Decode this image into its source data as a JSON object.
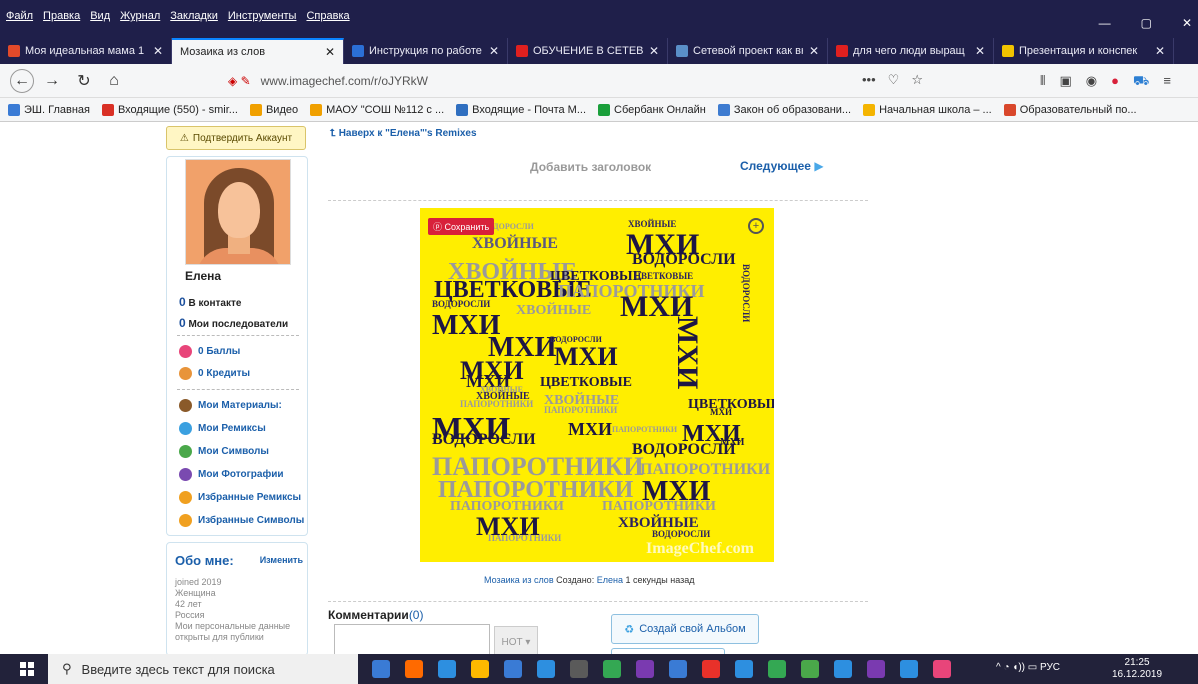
{
  "menu": [
    "Файл",
    "Правка",
    "Вид",
    "Журнал",
    "Закладки",
    "Инструменты",
    "Справка"
  ],
  "window_controls": [
    "—",
    "▢",
    "✕"
  ],
  "tabs": [
    {
      "label": "Моя идеальная мама 1",
      "icon_color": "#e24a2a",
      "active": false
    },
    {
      "label": "Мозаика из слов",
      "icon_color": "",
      "active": true
    },
    {
      "label": "Инструкция по работе",
      "icon_color": "#2b6fd6",
      "active": false
    },
    {
      "label": "ОБУЧЕНИЕ В СЕТЕВЫХ",
      "icon_color": "#e0201f",
      "active": false
    },
    {
      "label": "Сетевой проект как вне",
      "icon_color": "#5a8fc8",
      "active": false
    },
    {
      "label": "для чего люди выращ",
      "icon_color": "#e0201f",
      "active": false
    },
    {
      "label": "Презентация и конспек",
      "icon_color": "#f2c400",
      "active": false
    }
  ],
  "url": "www.imagechef.com/r/oJYRkW",
  "url_actions": [
    "•••",
    "♡",
    "☆"
  ],
  "bookmarks": [
    {
      "label": "ЭШ. Главная",
      "color": "#3a7bd5"
    },
    {
      "label": "Входящие (550) - smir...",
      "color": "#d93025"
    },
    {
      "label": "Видео",
      "color": "#f0a000"
    },
    {
      "label": "МАОУ \"СОШ №112 с ...",
      "color": "#f0a000"
    },
    {
      "label": "Входящие - Почта М...",
      "color": "#2f6fc0"
    },
    {
      "label": "Сбербанк Онлайн",
      "color": "#1a9f3b"
    },
    {
      "label": "Закон об образовани...",
      "color": "#3d7bd0"
    },
    {
      "label": "Начальная школа – ...",
      "color": "#f4b400"
    },
    {
      "label": "Образовательный по...",
      "color": "#d9472b"
    }
  ],
  "sidebar": {
    "verify": "Подтвердить Аккаунт",
    "username": "Елена",
    "stats": [
      {
        "num": "0",
        "label": "В контакте"
      },
      {
        "num": "0",
        "label": "Мои последователи"
      }
    ],
    "points": [
      {
        "label": "0 Баллы",
        "color": "#e8457a"
      },
      {
        "label": "0 Кредиты",
        "color": "#e8943a"
      }
    ],
    "links": [
      {
        "label": "Мои Материалы:",
        "color": "#8a5a2a"
      },
      {
        "label": "Мои Ремиксы",
        "color": "#3ba0e0"
      },
      {
        "label": "Мои Символы",
        "color": "#4aa84a"
      },
      {
        "label": "Мои Фотографии",
        "color": "#7a4ab0"
      },
      {
        "label": "Избранные Ремиксы",
        "color": "#f0a020"
      },
      {
        "label": "Избранные Символы",
        "color": "#f0a020"
      }
    ],
    "about": {
      "title": "Обо мне:",
      "edit": "Изменить",
      "lines": [
        "joined 2019",
        "Женщина",
        "42 лет",
        "Россия",
        "Мои персональные данные открыты для публики"
      ]
    }
  },
  "main": {
    "backlink": "Наверх к \"Елена\"'s Remixes",
    "add_title": "Добавить заголовок",
    "next": "Следующее",
    "save": "Сохранить",
    "watermark": "ImageChef.com",
    "caption_link": "Мозаика из слов",
    "caption_created": "Создано:",
    "caption_author": "Елена",
    "caption_time": "1 секунды назад",
    "comments_label": "Комментарии",
    "comments_count": "(0)",
    "create_album": "Создай свой Альбом",
    "hot_label": "HOT"
  },
  "mosaic_words": [
    {
      "t": "ВОДОРОСЛИ",
      "c": "#9b9a9a"
    },
    {
      "t": "ХВОЙНЫЕ",
      "c": "#5b5880"
    },
    {
      "t": "ХВОЙНЫЕ",
      "c": "#2b2260"
    },
    {
      "t": "МХИ",
      "c": "#1d1645"
    },
    {
      "t": "ВОДОРОСЛИ",
      "c": "#1d1645"
    },
    {
      "t": "ХВОЙНЫЕ",
      "c": "#9b9a9a"
    },
    {
      "t": "ЦВЕТКОВЫЕ",
      "c": "#1d1645"
    },
    {
      "t": "ВОДОРОСЛИ",
      "c": "#2b2260"
    },
    {
      "t": "МХИ",
      "c": "#1d1645"
    },
    {
      "t": "ЦВЕТКОВЫЕ",
      "c": "#1d1645"
    },
    {
      "t": "ПАПОРОТНИКИ",
      "c": "#9b9a9a"
    },
    {
      "t": "ЦВЕТКОВЫЕ",
      "c": "#2b2260"
    },
    {
      "t": "МХИ",
      "c": "#1d1645"
    },
    {
      "t": "ХВОЙНЫЕ",
      "c": "#9b9a9a"
    },
    {
      "t": "МХИ",
      "c": "#1d1645"
    },
    {
      "t": "МХИ",
      "c": "#1d1645"
    },
    {
      "t": "ВОДОРОСЛИ",
      "c": "#2b2260"
    },
    {
      "t": "МХИ",
      "c": "#1d1645"
    },
    {
      "t": "ВОДОРОСЛИ",
      "c": "#2b2260"
    },
    {
      "t": "МХИ",
      "c": "#1d1645"
    },
    {
      "t": "МХИ",
      "c": "#1d1645"
    },
    {
      "t": "ЦВЕТКОВЫЕ",
      "c": "#1d1645"
    },
    {
      "t": "ХВОЙНЫЕ",
      "c": "#2b2260"
    },
    {
      "t": "ПАПОРОТНИКИ",
      "c": "#9b9a9a"
    },
    {
      "t": "ХВОЙНЫЕ",
      "c": "#9b9a9a"
    },
    {
      "t": "ПАПОРОТНИКИ",
      "c": "#9b9a9a"
    },
    {
      "t": "МХИ",
      "c": "#1d1645"
    },
    {
      "t": "МХИ",
      "c": "#1d1645"
    },
    {
      "t": "МХИ",
      "c": "#1d1645"
    },
    {
      "t": "ВОДОРОСЛИ",
      "c": "#1d1645"
    },
    {
      "t": "ВОДОРОСЛИ",
      "c": "#1d1645"
    },
    {
      "t": "ПАПОРОТНИКИ",
      "c": "#9b9a9a"
    },
    {
      "t": "ПАПОРОТНИКИ",
      "c": "#9b9a9a"
    },
    {
      "t": "ПАПОРОТНИКИ",
      "c": "#9b9a9a"
    },
    {
      "t": "МХИ",
      "c": "#1d1645"
    },
    {
      "t": "ПАПОРОТНИКИ",
      "c": "#9b9a9a"
    },
    {
      "t": "ПАПОРОТНИКИ",
      "c": "#9b9a9a"
    },
    {
      "t": "МХИ",
      "c": "#1d1645"
    },
    {
      "t": "ХВОЙНЫЕ",
      "c": "#2b2260"
    },
    {
      "t": "ВОДОРОСЛИ",
      "c": "#2b2260"
    },
    {
      "t": "ПАПОРОТНИКИ",
      "c": "#9b9a9a"
    },
    {
      "t": "ЦВЕТКОВЫЕ",
      "c": "#1d1645"
    },
    {
      "t": "ПАПОРОТНИКИ",
      "c": "#9b9a9a"
    },
    {
      "t": "МХИ",
      "c": "#1d1645"
    },
    {
      "t": "МХИ",
      "c": "#1d1645"
    },
    {
      "t": "ХВОЙНЫЕ",
      "c": "#9b9a9a"
    }
  ],
  "taskbar": {
    "search_placeholder": "Введите здесь текст для поиска",
    "apps": [
      "#3a7bd5",
      "#ff6a00",
      "#2d8fe0",
      "#ffb900",
      "#3a7bd5",
      "#2d8fe0",
      "#5a5a5a",
      "#34a853",
      "#7a3ab0",
      "#3a7bd5",
      "#e8312a",
      "#2d8fe0",
      "#34a853",
      "#4aa84a",
      "#2d8fe0",
      "#7a3ab0",
      "#2d8fe0",
      "#e8457a"
    ],
    "tray": "^ ◔ ◖)) ▭ РУС",
    "time": "21:25",
    "date": "16.12.2019"
  },
  "colors": {
    "titlebar": "#1f1f4a",
    "mosaic_bg": "#ffee00",
    "accent": "#1b5faa"
  }
}
